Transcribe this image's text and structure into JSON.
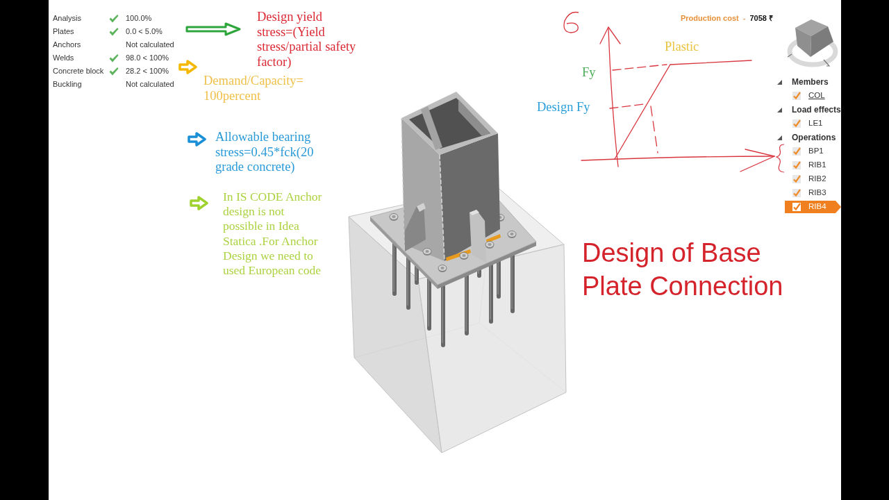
{
  "check_summary": [
    {
      "label": "Analysis",
      "passed": true,
      "value": "100.0%"
    },
    {
      "label": "Plates",
      "passed": true,
      "value": "0.0 < 5.0%"
    },
    {
      "label": "Anchors",
      "passed": false,
      "value": "Not calculated"
    },
    {
      "label": "Welds",
      "passed": true,
      "value": "98.0 < 100%"
    },
    {
      "label": "Concrete block",
      "passed": true,
      "value": "28.2 < 100%"
    },
    {
      "label": "Buckling",
      "passed": false,
      "value": "Not calculated"
    }
  ],
  "annotations": [
    {
      "arrow": {
        "kind": "long",
        "color": "#2ea63c"
      },
      "color": "#dc2a35",
      "lines": [
        "Design yield",
        "stress=(Yield",
        "stress/partial safety",
        "factor)"
      ]
    },
    {
      "arrow": {
        "kind": "short",
        "color": "#f5b800"
      },
      "color": "#f0bf48",
      "lines": [
        "Demand/Capacity=",
        "100percent"
      ]
    },
    {
      "arrow": {
        "kind": "short",
        "color": "#1b8fd6"
      },
      "color": "#2a9ad8",
      "lines": [
        "Allowable bearing",
        "stress=0.45*fck(20",
        "grade concrete)"
      ]
    },
    {
      "arrow": {
        "kind": "short",
        "color": "#9fd22e"
      },
      "color": "#acd240",
      "lines": [
        "In IS CODE Anchor",
        "design is not",
        "possible in Idea",
        "Statica .For Anchor",
        "Design we need to",
        "used European code"
      ]
    }
  ],
  "sketch": {
    "labels": [
      {
        "text": "Plastic",
        "color": "#e9c33c"
      },
      {
        "text": "Fy",
        "color": "#4cae58"
      },
      {
        "text": "Design Fy",
        "color": "#2b9fd9"
      }
    ]
  },
  "production_cost": {
    "label": "Production cost",
    "separator": "-",
    "value": "7058 ₹"
  },
  "model_tree": [
    {
      "label": "Members",
      "expanded": true,
      "children": [
        {
          "label": "COL",
          "checked": true,
          "selected": false,
          "hovered": true
        }
      ]
    },
    {
      "label": "Load effects",
      "expanded": true,
      "children": [
        {
          "label": "LE1",
          "checked": true,
          "selected": false,
          "hovered": false
        }
      ]
    },
    {
      "label": "Operations",
      "expanded": true,
      "children": [
        {
          "label": "BP1",
          "checked": true,
          "selected": false,
          "hovered": false
        },
        {
          "label": "RIB1",
          "checked": true,
          "selected": false,
          "hovered": false
        },
        {
          "label": "RIB2",
          "checked": true,
          "selected": false,
          "hovered": false
        },
        {
          "label": "RIB3",
          "checked": true,
          "selected": false,
          "hovered": false
        },
        {
          "label": "RIB4",
          "checked": true,
          "selected": true,
          "hovered": false
        }
      ]
    }
  ],
  "title": {
    "lines": [
      "Design of Base",
      "Plate Connection"
    ]
  }
}
